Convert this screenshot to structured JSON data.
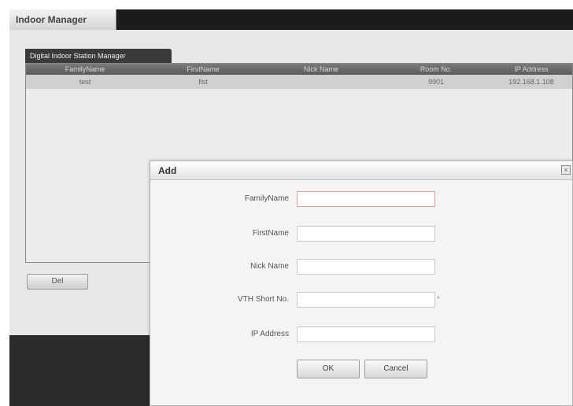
{
  "app": {
    "title": "Indoor Manager"
  },
  "panel": {
    "tab_label": "Digital Indoor Station Manager"
  },
  "table": {
    "columns": [
      "FamilyName",
      "FirstName",
      "Nick Name",
      "Room No.",
      "IP Address"
    ],
    "rows": [
      [
        "test",
        "fist",
        "",
        "9901",
        "192.168.1.108"
      ]
    ]
  },
  "toolbar": {
    "delete_label": "Del"
  },
  "dialog": {
    "title": "Add",
    "fields": [
      {
        "label": "FamilyName",
        "value": ""
      },
      {
        "label": "FirstName",
        "value": ""
      },
      {
        "label": "Nick Name",
        "value": ""
      },
      {
        "label": "VTH Short No.",
        "value": "",
        "required_mark": "*"
      },
      {
        "label": "IP Address",
        "value": ""
      }
    ],
    "ok_label": "OK",
    "cancel_label": "Cancel"
  }
}
